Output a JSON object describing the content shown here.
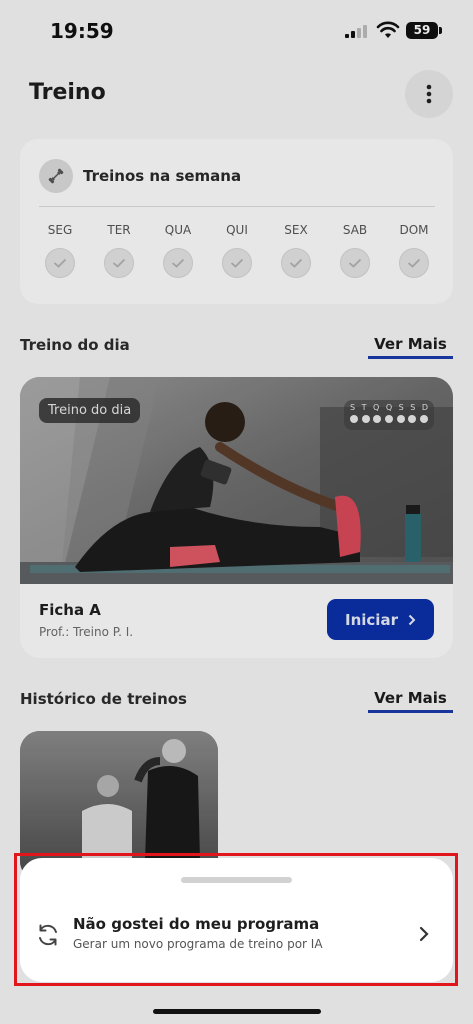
{
  "status": {
    "time": "19:59",
    "battery": "59"
  },
  "header": {
    "title": "Treino",
    "more_icon": "more-vertical-icon"
  },
  "week": {
    "title": "Treinos na semana",
    "days": [
      "SEG",
      "TER",
      "QUA",
      "QUI",
      "SEX",
      "SAB",
      "DOM"
    ]
  },
  "daily": {
    "section_title": "Treino do dia",
    "see_more": "Ver Mais",
    "chip": "Treino do dia",
    "week_letters": [
      "S",
      "T",
      "Q",
      "Q",
      "S",
      "S",
      "D"
    ],
    "workout_name": "Ficha A",
    "trainer": "Prof.: Treino P. I.",
    "start_label": "Iniciar"
  },
  "history": {
    "section_title": "Histórico de treinos",
    "see_more": "Ver Mais"
  },
  "sheet": {
    "title": "Não gostei do meu programa",
    "subtitle": "Gerar um novo programa de treino por IA",
    "icon": "refresh-icon"
  },
  "colors": {
    "accent": "#0b2fa8",
    "highlight_border": "#e0161b"
  }
}
